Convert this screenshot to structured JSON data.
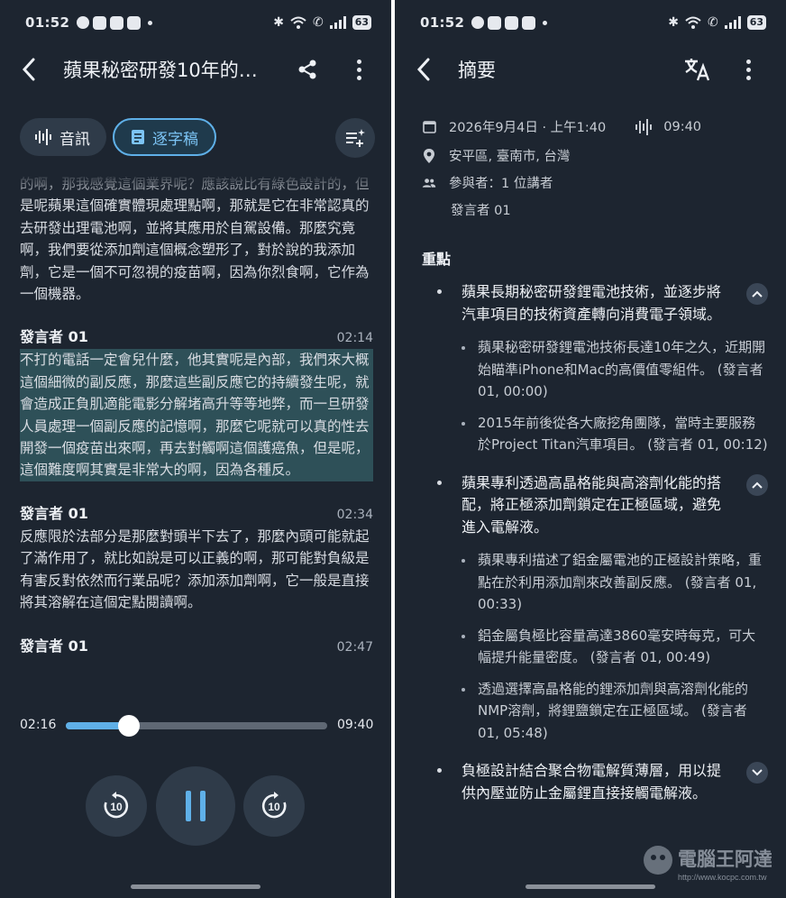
{
  "left": {
    "status": {
      "time": "01:52",
      "battery": "63"
    },
    "title": "蘋果秘密研發10年的…",
    "tabs": {
      "audio": "音訊",
      "transcript": "逐字稿"
    },
    "transcript": {
      "intro": "的啊，那我感覺這個業界呢？應該說比有綠色設計的，但是呢蘋果這個確實體現處理點啊，那就是它在非常認真的去研發出理電池啊，並將其應用於自駕設備。那麼究竟啊，我們要從添加劑這個概念塑形了，對於說的我添加劑，它是一個不可忽視的疫苗啊，因為你烈食啊，它作為一個機器。",
      "segments": [
        {
          "speaker": "發言者 01",
          "time": "02:14",
          "text": "不打的電話一定會兒什麼，他其實呢是內部，我們來大概這個細微的副反應，那麼這些副反應它的持續發生呢，就會造成正負肌適能電影分解堵高升等等地弊，而一旦研發人員處理一個副反應的記憶啊，那麼它呢就可以真的性去開發一個疫苗出來啊，再去對觸啊這個護癌魚，但是呢，這個難度啊其實是非常大的啊，因為各種反。"
        },
        {
          "speaker": "發言者 01",
          "time": "02:34",
          "text": "反應限於法部分是那麼對頭半下去了，那麼內頭可能就起了滿作用了，就比如說是可以正義的啊，那可能對負級是有害反對依然而行業品呢？添加添加劑啊，它一般是直接將其溶解在這個定點閱讀啊。"
        },
        {
          "speaker": "發言者 01",
          "time": "02:47",
          "text": ""
        }
      ]
    },
    "player": {
      "position": "02:16",
      "duration": "09:40",
      "progress": 0.24,
      "skip_back": "10",
      "skip_forward": "10"
    }
  },
  "right": {
    "status": {
      "time": "01:52",
      "battery": "63"
    },
    "title": "摘要",
    "meta": {
      "date": "2026年9月4日 · 上午1:40",
      "length": "09:40",
      "location": "安平區, 臺南市, 台灣",
      "participants": "參與者：1 位講者",
      "speaker": "發言者 01"
    },
    "key_points_title": "重點",
    "key_points": [
      {
        "text": "蘋果長期秘密研發鋰電池技術，並逐步將汽車項目的技術資產轉向消費電子領域。",
        "expanded": true,
        "subs": [
          "蘋果秘密研發鋰電池技術長達10年之久，近期開始瞄準iPhone和Mac的高價值零組件。 (發言者 01, 00:00)",
          "2015年前後從各大廠挖角團隊，當時主要服務於Project Titan汽車項目。 (發言者 01, 00:12)"
        ]
      },
      {
        "text": "蘋果專利透過高晶格能與高溶劑化能的搭配，將正極添加劑鎖定在正極區域，避免進入電解液。",
        "expanded": true,
        "subs": [
          "蘋果專利描述了鋁金屬電池的正極設計策略，重點在於利用添加劑來改善副反應。 (發言者 01, 00:33)",
          "鋁金屬負極比容量高達3860毫安時每克，可大幅提升能量密度。 (發言者 01, 00:49)",
          "透過選擇高晶格能的鋰添加劑與高溶劑化能的NMP溶劑，將鋰鹽鎖定在正極區域。 (發言者 01, 05:48)"
        ]
      },
      {
        "text": "負極設計結合聚合物電解質薄層，用以提供內壓並防止金屬鋰直接接觸電解液。",
        "expanded": false,
        "subs": []
      }
    ],
    "watermark": "電腦王阿達",
    "watermark_url": "http://www.kocpc.com.tw"
  }
}
